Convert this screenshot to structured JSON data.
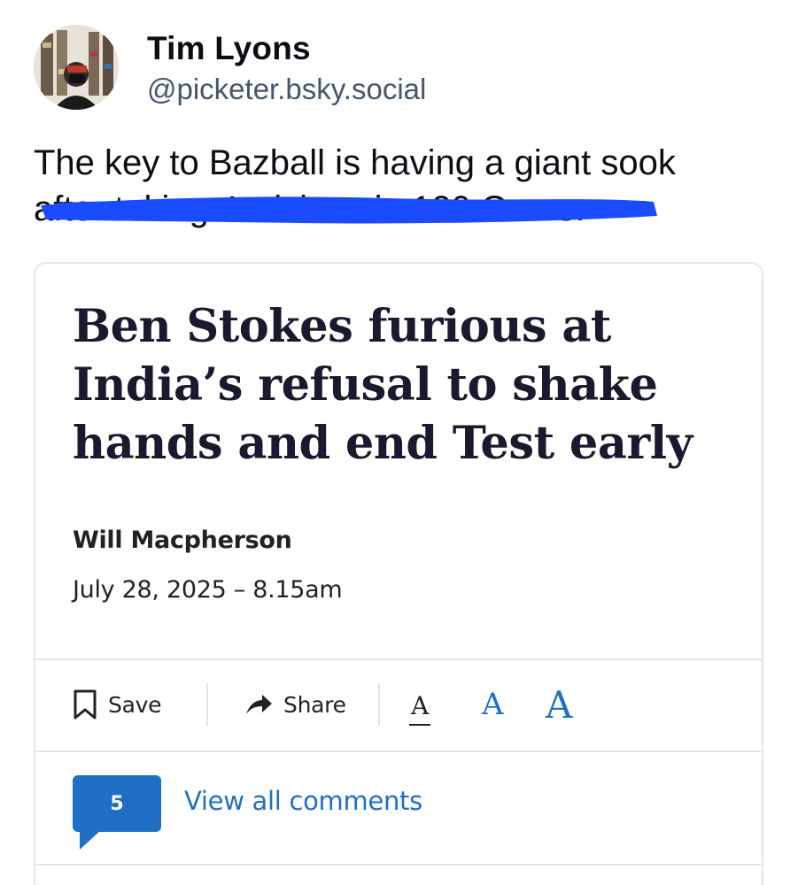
{
  "post": {
    "author_name": "Tim Lyons",
    "author_handle": "@picketer.bsky.social",
    "text_line1": "The key to Bazball is having a giant sook",
    "text_line2": "after taking 4 wickets in 120 Overs.",
    "redaction_color": "#1a4bff"
  },
  "embed": {
    "headline": "Ben Stokes furious at India’s refusal to shake hands and end Test early",
    "author": "Will Macpherson",
    "date": "July 28, 2025 – 8.15am",
    "toolbar": {
      "save_label": "Save",
      "share_label": "Share",
      "font_sizes": [
        "A",
        "A",
        "A"
      ]
    },
    "comments": {
      "count": "5",
      "link_label": "View all comments"
    },
    "accent_color": "#1f6fc6"
  }
}
